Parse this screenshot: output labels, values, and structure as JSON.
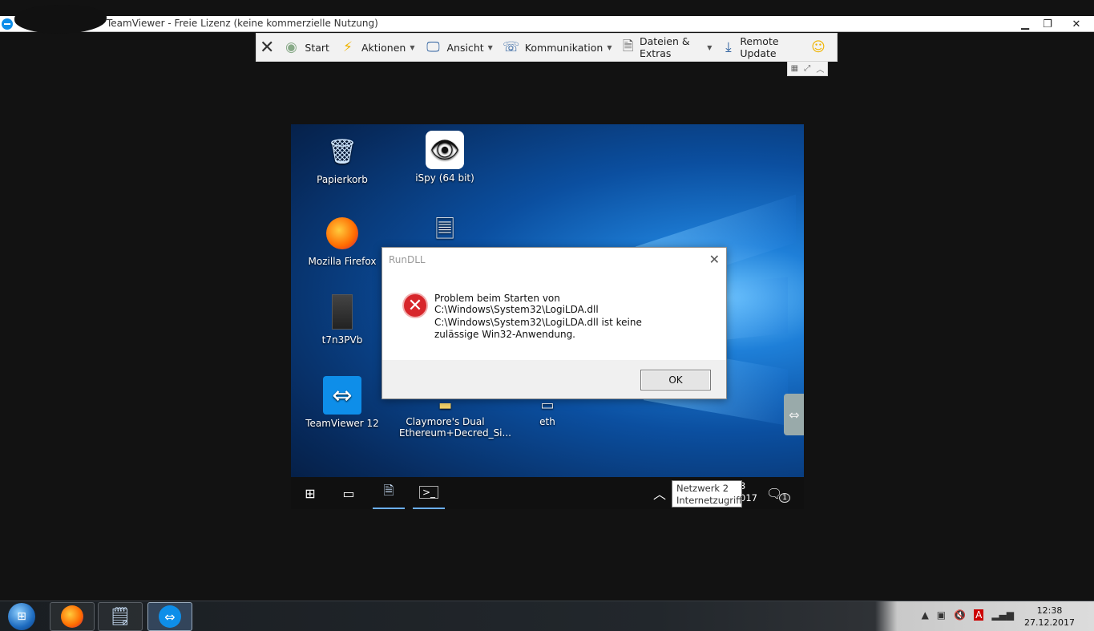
{
  "window": {
    "title": "TeamViewer - Freie Lizenz (keine kommerzielle Nutzung)",
    "buttons": {
      "minimize": "▁",
      "restore": "❐",
      "close": "✕"
    }
  },
  "toolbar": {
    "items": [
      {
        "label": "Start",
        "icon": "start-icon"
      },
      {
        "label": "Aktionen",
        "icon": "lightning-icon"
      },
      {
        "label": "Ansicht",
        "icon": "monitor-icon"
      },
      {
        "label": "Kommunikation",
        "icon": "phone-icon"
      },
      {
        "label": "Dateien & Extras",
        "icon": "files-icon"
      },
      {
        "label": "Remote Update",
        "icon": "download-icon"
      }
    ]
  },
  "desktop": {
    "icons": [
      {
        "label": "Papierkorb",
        "icon": "recycle-bin-icon"
      },
      {
        "label": "iSpy (64 bit)",
        "icon": "eye-icon"
      },
      {
        "label": "Mozilla Firefox",
        "icon": "firefox-icon"
      },
      {
        "label": "t7n3PVb",
        "icon": "file-icon"
      },
      {
        "label": "TeamViewer 12",
        "icon": "teamviewer-icon"
      },
      {
        "label": "Claymore's Dual Ethereum+Decred_Si...",
        "icon": "folder-icon"
      },
      {
        "label": "eth",
        "icon": "document-icon"
      }
    ]
  },
  "dialog": {
    "title": "RunDLL",
    "message1": "Problem beim Starten von C:\\Windows\\System32\\LogiLDA.dll",
    "message2": "C:\\Windows\\System32\\LogiLDA.dll ist keine zulässige Win32-Anwendung.",
    "ok_label": "OK"
  },
  "remote_taskbar": {
    "tooltip_line1": "Netzwerk  2",
    "tooltip_line2": "Internetzugriff",
    "clock_partial_line1": "3",
    "clock_partial_line2": "017",
    "notification_count": "1"
  },
  "host_taskbar": {
    "time": "12:38",
    "date": "27.12.2017"
  }
}
